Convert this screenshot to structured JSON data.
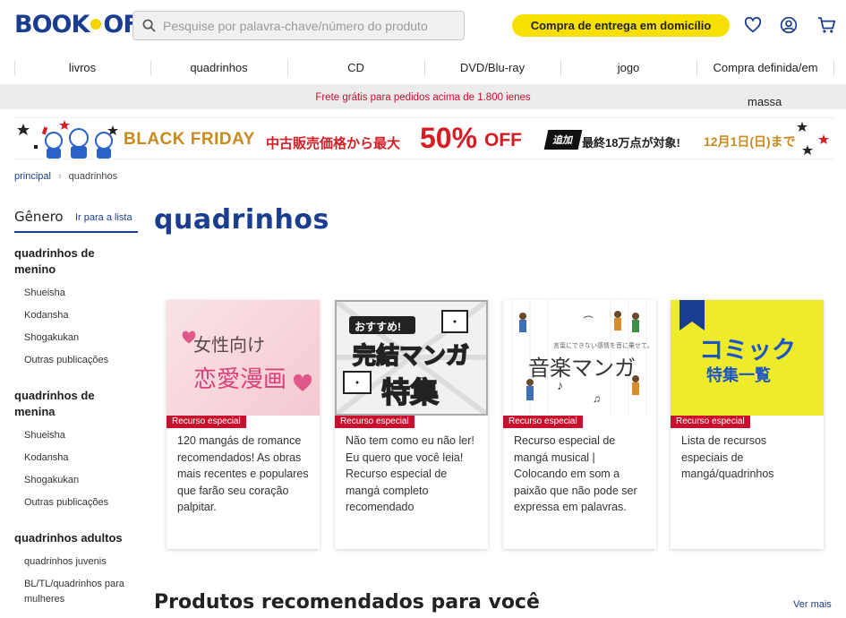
{
  "header": {
    "logo": "BOOK OFF",
    "search_placeholder": "Pesquise por palavra-chave/número do produto",
    "delivery_label": "Compra de entrega em domicílio"
  },
  "nav": {
    "items": [
      "livros",
      "quadrinhos",
      "CD",
      "DVD/Blu-ray",
      "jogo",
      "Compra definida/em"
    ],
    "overflow": "massa"
  },
  "shipping_notice": "Frete grátis para pedidos acima de 1.800 ienes",
  "banner": {
    "black_friday": "BLACK FRIDAY",
    "jp_lead": "中古販売価格から最大",
    "percent": "50%",
    "off": "OFF",
    "tag": "追加",
    "jp_detail": "最終18万点が対象!",
    "date": "12月1日(日)まで"
  },
  "breadcrumb": {
    "home": "principal",
    "current": "quadrinhos"
  },
  "sidebar": {
    "title": "Gênero",
    "link": "Ir para a lista",
    "groups": [
      {
        "title": "quadrinhos de menino",
        "items": [
          "Shueisha",
          "Kodansha",
          "Shogakukan",
          "Outras publicações"
        ]
      },
      {
        "title": "quadrinhos de menina",
        "items": [
          "Shueisha",
          "Kodansha",
          "Shogakukan",
          "Outras publicações"
        ]
      },
      {
        "title": "quadrinhos adultos",
        "items": [
          "quadrinhos juvenis",
          "BL/TL/quadrinhos para mulheres"
        ]
      }
    ]
  },
  "page_title": "quadrinhos",
  "cards": [
    {
      "badge": "Recurso especial",
      "image_text_1": "女性向け",
      "image_text_2": "恋愛漫画",
      "desc": "120 mangás de romance recomendados! As obras mais recentes e populares que farão seu coração palpitar."
    },
    {
      "badge": "Recurso especial",
      "image_text_1": "おすすめ!",
      "image_text_2": "完結マンガ",
      "image_text_3": "特集",
      "desc": "Não tem como eu não ler! Eu quero que você leia! Recurso especial de mangá completo recomendado"
    },
    {
      "badge": "Recurso especial",
      "image_text_1": "音楽マンガ",
      "image_text_2": "言葉にできない感情を音に乗せて。",
      "desc": "Recurso especial de mangá musical | Colocando em som a paixão que não pode ser expressa em palavras."
    },
    {
      "badge": "Recurso especial",
      "image_text_1": "コミック",
      "image_text_2": "特集一覧",
      "desc": "Lista de recursos especiais de mangá/quadrinhos"
    }
  ],
  "recommended": {
    "title": "Produtos recomendados para você",
    "see_more": "Ver mais"
  }
}
